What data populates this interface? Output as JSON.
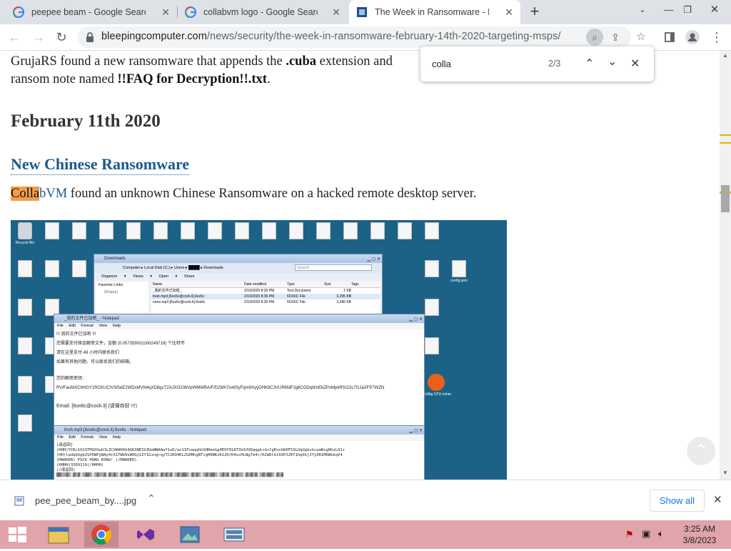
{
  "tabs": [
    {
      "title": "peepee beam - Google Search",
      "icon": "google-icon"
    },
    {
      "title": "collabvm logo - Google Search",
      "icon": "google-icon"
    },
    {
      "title": "The Week in Ransomware - Febr",
      "icon": "bleepingcomputer-icon"
    }
  ],
  "toolbar": {
    "url_domain": "bleepingcomputer.com",
    "url_path": "/news/security/the-week-in-ransomware-february-14th-2020-targeting-msps/"
  },
  "find": {
    "query": "colla",
    "count": "2/3"
  },
  "article": {
    "p1_start": "GrujaRS found a new ransomware that appends the ",
    "p1_bold": ".cuba",
    "p1_end": " extension and",
    "p2_start": "ransom note named ",
    "p2_bold": "!!FAQ for Decryption!!.txt",
    "p2_end": ".",
    "date_heading": "February 11th 2020",
    "section_heading": "New Chinese Ransomware",
    "body_highlight": "Colla",
    "body_link": "bVM",
    "body_rest": " found an unknown Chinese Ransomware on a hacked remote desktop server."
  },
  "screenshot": {
    "explorer_title": "Downloads",
    "explorer_path": "Computer ▸ Local Disk (C:) ▸ Users ▸ ████ ▸ Downloads",
    "explorer_search": "Search",
    "explorer_menu": [
      "Organize ▾",
      "Views ▾",
      "Open ▾",
      "Share"
    ],
    "explorer_columns": [
      "Name",
      "Date modified",
      "Type",
      "Size",
      "Tags"
    ],
    "explorer_rows": [
      [
        "_我的文件已加密_",
        "2/10/2020 8:30 PM",
        "Text Document",
        "1 KB"
      ],
      [
        "bruh.mp3.[6ox6c@cock.li].6ox6c",
        "2/10/2020 8:30 PM",
        "6OX6C File",
        "3,295 KB"
      ],
      [
        "none.mp3.[6ox6c@cock.li].6ox6c",
        "2/10/2020 8:30 PM",
        "6OX6C File",
        "3,280 KB"
      ]
    ],
    "sidebar_links": [
      "Favorite Links",
      "(Empty)"
    ],
    "note1_title": "_我的文件已加密_ - Notepad",
    "notepad_menu": [
      "File",
      "Edit",
      "Format",
      "View",
      "Help"
    ],
    "note1_lines": [
      "!!! 我的文件已加密 !!!",
      "您需要支付赎金解密文件，金额 (0.057359031160249718) 个比特币",
      "请在这里支付 48 小时内联系我们",
      "如果有其他问题，可以联系我们的邮箱。",
      "",
      "您的解密密钥 :",
      "RV/FauMXCtHIGY1RCKUCtV3iSeE2WDsMVN4qXD8gcT2AJXO10bVpWMWBA/F/D2Mh7xv6SyFqm9XyyOHK6C3VURMdFJg8CGDqWnEbZPxMpkRSr22c7GJaXFP7WZN",
      "",
      "Email: [6ox6c@cock.li] (请保存好 !!!)"
    ],
    "note2_title": "bruh.mp3.[6ox6c@cock.li].6ox6c - Notepad",
    "note2_lines": [
      "[请返回]",
      "(HHH)YCRc1O2STM2OSwUJLZCVWAHXk9GK3NEIG3UeWNAAwY1uD/ax1IFxwqqhhSHHeeGg0EOY01AT3k9JUQqqpkrdsfgEnxG60F53LUqUgGskcumRcgHGxLQ1+",
      "(HH)tadqb5gb2SPOWPyWAy4+X1TWb9vW0Gy1IY1GingrqyTC2RO4EL2GOMngBTcgH6NKzK12H/K4ocHLNg7b4r/KZmDtGtXXPJ2KY1hqXkjJ7yXR1M6WkkqV4",
      "(MARKER) FUCK HONG KONG! (/MARKER)",
      "(HHHH)3309119(/HHHH)",
      "(/请返回)"
    ],
    "icon_labels": [
      "Recycle Bin",
      "_我的文件已加密__",
      "config.json",
      "XeBig CPU miner",
      "ddop.7z",
      "我的文件已加密"
    ]
  },
  "download": {
    "filename": "pee_pee_beam_by....jpg",
    "show_all": "Show all"
  },
  "clock": {
    "time": "3:25 AM",
    "date": "3/8/2023"
  },
  "colors": {
    "tabbar": "#dee1e6",
    "taskbar": "#e0a4aa",
    "link": "#1a5a8e",
    "highlight": "#f29d4b",
    "desktop": "#1c6287"
  }
}
